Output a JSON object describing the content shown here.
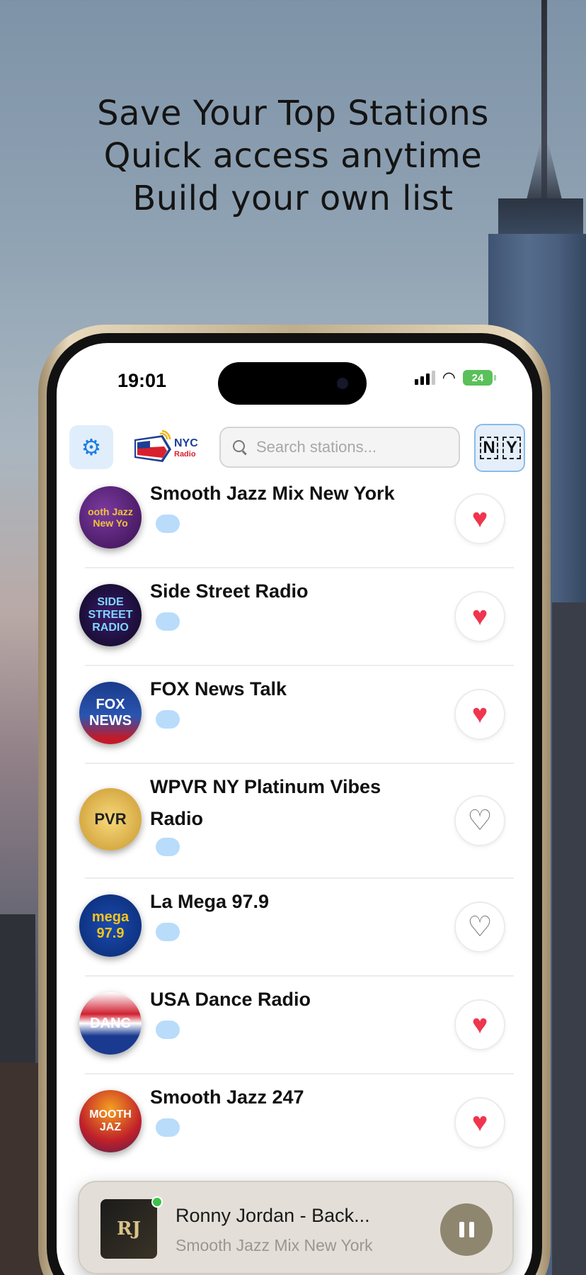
{
  "promo": {
    "line1": "Save Your Top Stations",
    "line2": "Quick access anytime",
    "line3": "Build your own list"
  },
  "status_bar": {
    "time": "19:01",
    "battery": "24"
  },
  "toolbar": {
    "logo_text": "NYC",
    "logo_sub": "Radio",
    "search_placeholder": "Search stations...",
    "chip_letters": [
      "N",
      "Y"
    ]
  },
  "stations": [
    {
      "name": "Smooth Jazz Mix New York",
      "logo_text": "ooth Jazz New Yo",
      "favorite": true
    },
    {
      "name": "Side Street Radio",
      "logo_text": "SIDE STREET RADIO",
      "favorite": true
    },
    {
      "name": "FOX News Talk",
      "logo_text": "FOX NEWS",
      "favorite": true
    },
    {
      "name": "WPVR NY Platinum Vibes Radio",
      "logo_text": "PVR",
      "favorite": false
    },
    {
      "name": "La Mega 97.9",
      "logo_text": "mega 97.9",
      "favorite": false
    },
    {
      "name": "USA Dance Radio",
      "logo_text": "DANC",
      "favorite": true
    },
    {
      "name": "Smooth Jazz 247",
      "logo_text": "MOOTH JAZ",
      "favorite": true
    }
  ],
  "now_playing": {
    "title": "Ronny Jordan - Back...",
    "station": "Smooth Jazz Mix New York",
    "art_text": "RJ"
  },
  "colors": {
    "accent": "#1f7de0",
    "heart": "#f0354e",
    "tag": "#b9dcfb"
  }
}
